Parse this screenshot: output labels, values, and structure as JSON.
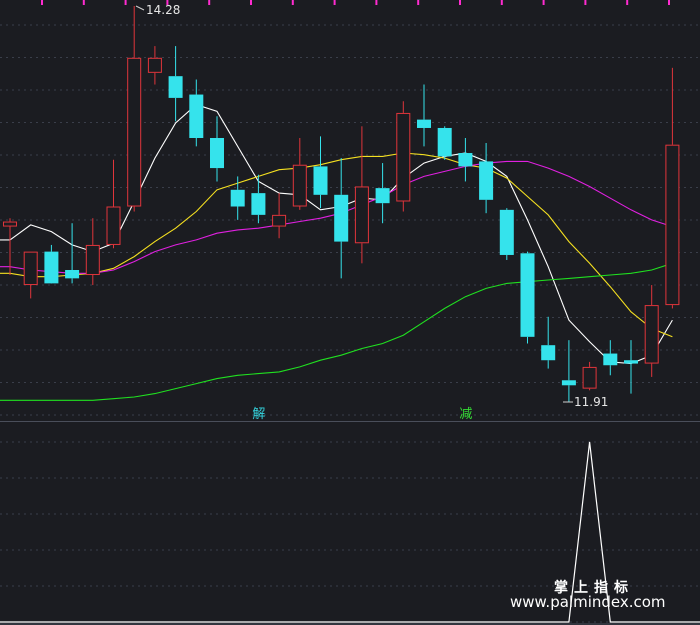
{
  "chart_data": [
    {
      "type": "candlestick",
      "panel": "main",
      "high_annotation": "14.28",
      "low_annotation": "11.91",
      "signals": [
        {
          "label": "解",
          "bar": 12,
          "color": "#35d6e0"
        },
        {
          "label": "减",
          "bar": 22,
          "color": "#35e035"
        }
      ],
      "candles": [
        {
          "o": 12.96,
          "h": 13.01,
          "l": 12.67,
          "c": 12.99
        },
        {
          "o": 12.61,
          "h": 12.81,
          "l": 12.53,
          "c": 12.81
        },
        {
          "o": 12.81,
          "h": 12.85,
          "l": 12.63,
          "c": 12.62
        },
        {
          "o": 12.7,
          "h": 12.98,
          "l": 12.62,
          "c": 12.65
        },
        {
          "o": 12.67,
          "h": 13.01,
          "l": 12.61,
          "c": 12.85
        },
        {
          "o": 12.85,
          "h": 13.36,
          "l": 12.83,
          "c": 13.08
        },
        {
          "o": 13.08,
          "h": 14.28,
          "l": 13.05,
          "c": 13.97
        },
        {
          "o": 13.88,
          "h": 14.04,
          "l": 13.81,
          "c": 13.97
        },
        {
          "o": 13.86,
          "h": 14.04,
          "l": 13.59,
          "c": 13.73
        },
        {
          "o": 13.75,
          "h": 13.84,
          "l": 13.44,
          "c": 13.49
        },
        {
          "o": 13.49,
          "h": 13.62,
          "l": 13.23,
          "c": 13.31
        },
        {
          "o": 13.18,
          "h": 13.26,
          "l": 13.0,
          "c": 13.08
        },
        {
          "o": 13.16,
          "h": 13.27,
          "l": 12.98,
          "c": 13.03
        },
        {
          "o": 12.96,
          "h": 13.16,
          "l": 12.89,
          "c": 13.03
        },
        {
          "o": 13.08,
          "h": 13.49,
          "l": 13.06,
          "c": 13.33
        },
        {
          "o": 13.32,
          "h": 13.5,
          "l": 13.07,
          "c": 13.15
        },
        {
          "o": 13.15,
          "h": 13.37,
          "l": 12.65,
          "c": 12.87
        },
        {
          "o": 12.86,
          "h": 13.56,
          "l": 12.74,
          "c": 13.2
        },
        {
          "o": 13.19,
          "h": 13.34,
          "l": 12.98,
          "c": 13.1
        },
        {
          "o": 13.11,
          "h": 13.71,
          "l": 13.05,
          "c": 13.64
        },
        {
          "o": 13.6,
          "h": 13.81,
          "l": 13.44,
          "c": 13.55
        },
        {
          "o": 13.55,
          "h": 13.56,
          "l": 13.36,
          "c": 13.38
        },
        {
          "o": 13.4,
          "h": 13.49,
          "l": 13.23,
          "c": 13.32
        },
        {
          "o": 13.35,
          "h": 13.46,
          "l": 13.04,
          "c": 13.12
        },
        {
          "o": 13.06,
          "h": 13.07,
          "l": 12.76,
          "c": 12.79
        },
        {
          "o": 12.8,
          "h": 12.81,
          "l": 12.26,
          "c": 12.3
        },
        {
          "o": 12.25,
          "h": 12.42,
          "l": 12.11,
          "c": 12.16
        },
        {
          "o": 12.04,
          "h": 12.28,
          "l": 11.91,
          "c": 12.01
        },
        {
          "o": 11.99,
          "h": 12.15,
          "l": 11.98,
          "c": 12.12
        },
        {
          "o": 12.2,
          "h": 12.28,
          "l": 12.07,
          "c": 12.13
        },
        {
          "o": 12.16,
          "h": 12.28,
          "l": 11.96,
          "c": 12.14
        },
        {
          "o": 12.14,
          "h": 12.61,
          "l": 12.06,
          "c": 12.49
        },
        {
          "o": 12.49,
          "h": 13.91,
          "l": 12.47,
          "c": 13.45
        }
      ],
      "moving_averages": [
        {
          "name": "MA5",
          "color": "#ffffff",
          "values": [
            12.88,
            12.97,
            12.93,
            12.85,
            12.81,
            12.86,
            13.11,
            13.37,
            13.58,
            13.69,
            13.65,
            13.44,
            13.23,
            13.16,
            13.15,
            13.06,
            13.08,
            13.13,
            13.12,
            13.25,
            13.34,
            13.38,
            13.4,
            13.35,
            13.26,
            13.0,
            12.72,
            12.4,
            12.27,
            12.15,
            12.14,
            12.19,
            12.4
          ]
        },
        {
          "name": "MA10",
          "color": "#f5e020",
          "values": [
            12.68,
            12.66,
            12.66,
            12.67,
            12.68,
            12.71,
            12.78,
            12.87,
            12.95,
            13.05,
            13.18,
            13.22,
            13.26,
            13.3,
            13.31,
            13.33,
            13.36,
            13.38,
            13.38,
            13.4,
            13.39,
            13.37,
            13.33,
            13.31,
            13.25,
            13.14,
            13.03,
            12.87,
            12.74,
            12.6,
            12.45,
            12.35,
            12.3
          ]
        },
        {
          "name": "MA20",
          "color": "#e020e0",
          "values": [
            12.72,
            12.7,
            12.69,
            12.68,
            12.68,
            12.7,
            12.75,
            12.81,
            12.85,
            12.88,
            12.92,
            12.94,
            12.95,
            12.97,
            12.99,
            13.01,
            13.04,
            13.09,
            13.14,
            13.21,
            13.26,
            13.29,
            13.32,
            13.34,
            13.35,
            13.35,
            13.31,
            13.26,
            13.2,
            13.13,
            13.06,
            13.0,
            12.96
          ]
        },
        {
          "name": "MA60",
          "color": "#20e020",
          "values": [
            11.92,
            11.92,
            11.92,
            11.92,
            11.92,
            11.93,
            11.94,
            11.96,
            11.99,
            12.02,
            12.05,
            12.07,
            12.08,
            12.09,
            12.12,
            12.16,
            12.19,
            12.23,
            12.26,
            12.31,
            12.39,
            12.47,
            12.54,
            12.59,
            12.62,
            12.63,
            12.64,
            12.65,
            12.66,
            12.67,
            12.68,
            12.7,
            12.74
          ]
        }
      ]
    },
    {
      "type": "line",
      "panel": "indicator",
      "color": "#ffffff",
      "ylim": [
        0,
        1
      ],
      "values": [
        0,
        0,
        0,
        0,
        0,
        0,
        0,
        0,
        0,
        0,
        0,
        0,
        0,
        0,
        0,
        0,
        0,
        0,
        0,
        0,
        0,
        0,
        0,
        0,
        0,
        0,
        0,
        0,
        1,
        0,
        0,
        0,
        0
      ]
    }
  ],
  "colors": {
    "background": "#1b1c21",
    "up": "#e0353b",
    "down": "#35e3ec",
    "grid": "#3a3e4a",
    "tick": "#ff2bd0"
  },
  "watermark": {
    "cn": "掌上指标",
    "url": "www.palmindex.com"
  }
}
